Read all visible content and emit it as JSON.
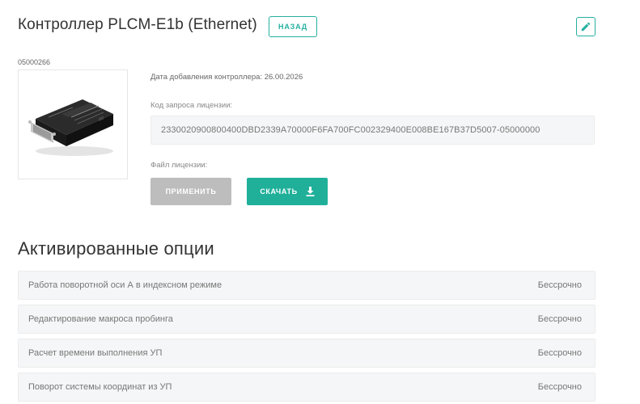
{
  "header": {
    "title": "Контроллер PLCM-E1b (Ethernet)",
    "back_label": "НАЗАД",
    "edit_icon": "pencil-icon"
  },
  "device": {
    "serial": "05000266",
    "image_icon": "controller-device-image",
    "date_added": "Дата добавления контроллера: 26.00.2026"
  },
  "license": {
    "request_label": "Код запроса лицензии:",
    "request_code": "2330020900800400DBD2339A70000F6FA700FC002329400E008BE167B37D5007-05000000",
    "file_label": "Файл лицензии:",
    "apply_label": "ПРИМЕНИТЬ",
    "download_label": "СКАЧАТЬ",
    "download_icon": "download-icon"
  },
  "options": {
    "title": "Активированные опции",
    "items": [
      {
        "name": "Работа поворотной оси А в индексном режиме",
        "status": "Бессрочно"
      },
      {
        "name": "Редактирование макроса пробинга",
        "status": "Бессрочно"
      },
      {
        "name": "Расчет времени выполнения УП",
        "status": "Бессрочно"
      },
      {
        "name": "Поворот системы координат из УП",
        "status": "Бессрочно"
      }
    ]
  },
  "colors": {
    "accent": "#26b0a0",
    "disabled": "#bdbdbd"
  }
}
